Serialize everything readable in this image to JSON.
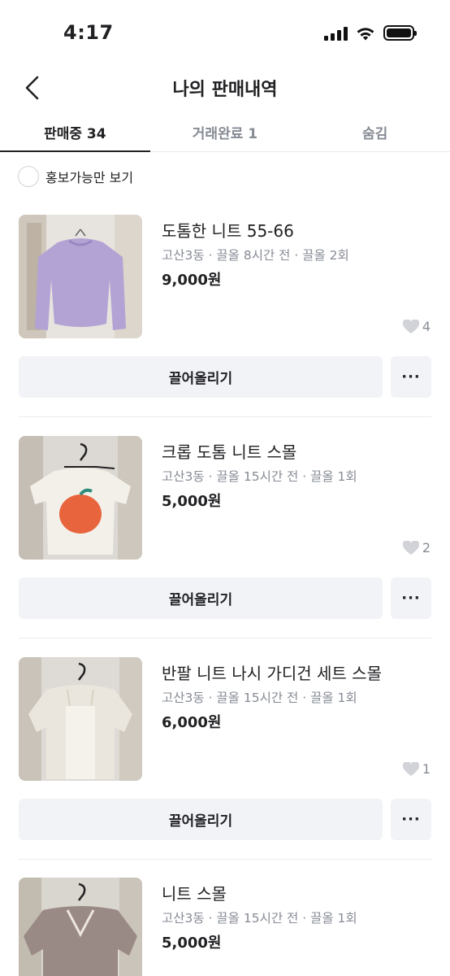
{
  "status": {
    "time": "4:17"
  },
  "header": {
    "title": "나의 판매내역"
  },
  "tabs": [
    {
      "label": "판매중 34",
      "active": true
    },
    {
      "label": "거래완료 1",
      "active": false
    },
    {
      "label": "숨김",
      "active": false
    }
  ],
  "filter": {
    "label": "홍보가능만 보기"
  },
  "items": [
    {
      "title": "도톰한 니트 55-66",
      "meta": "고산3동 · 끌올 8시간 전 · 끌올 2회",
      "price": "9,000원",
      "likes": "4",
      "bump_label": "끌어올리기",
      "more_label": "···"
    },
    {
      "title": "크롭 도톰 니트 스몰",
      "meta": "고산3동 · 끌올 15시간 전 · 끌올 1회",
      "price": "5,000원",
      "likes": "2",
      "bump_label": "끌어올리기",
      "more_label": "···"
    },
    {
      "title": "반팔 니트 나시 가디건 세트 스몰",
      "meta": "고산3동 · 끌올 15시간 전 · 끌올 1회",
      "price": "6,000원",
      "likes": "1",
      "bump_label": "끌어올리기",
      "more_label": "···"
    },
    {
      "title": "니트 스몰",
      "meta": "고산3동 · 끌올 15시간 전 · 끌올 1회",
      "price": "5,000원"
    }
  ]
}
